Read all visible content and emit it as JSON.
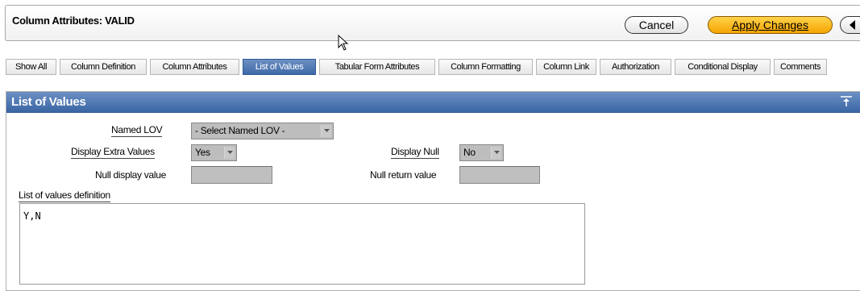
{
  "header": {
    "title": "Column Attributes: VALID",
    "cancel_label": "Cancel",
    "apply_label": "Apply Changes"
  },
  "tabs": [
    {
      "label": "Show All",
      "active": false
    },
    {
      "label": "Column Definition",
      "active": false
    },
    {
      "label": "Column Attributes",
      "active": false
    },
    {
      "label": "List of Values",
      "active": true
    },
    {
      "label": "Tabular Form Attributes",
      "active": false
    },
    {
      "label": "Column Formatting",
      "active": false
    },
    {
      "label": "Column Link",
      "active": false
    },
    {
      "label": "Authorization",
      "active": false
    },
    {
      "label": "Conditional Display",
      "active": false
    },
    {
      "label": "Comments",
      "active": false
    }
  ],
  "region": {
    "title": "List of Values",
    "named_lov_label": "Named LOV",
    "named_lov_value": "- Select Named LOV -",
    "display_extra_label": "Display Extra Values",
    "display_extra_value": "Yes",
    "display_null_label": "Display Null",
    "display_null_value": "No",
    "null_display_label": "Null display value",
    "null_display_value": "",
    "null_return_label": "Null return value",
    "null_return_value": "",
    "lov_definition_label": "List of values definition",
    "lov_definition_value": "Y,N"
  },
  "colors": {
    "accent": "#3e6aa8",
    "apply_button": "#f5a400",
    "field_bg": "#bdbdbd"
  },
  "icons": [
    "cursor-icon",
    "chevron-left-icon",
    "collapse-top-icon",
    "dropdown-arrow-icon"
  ]
}
